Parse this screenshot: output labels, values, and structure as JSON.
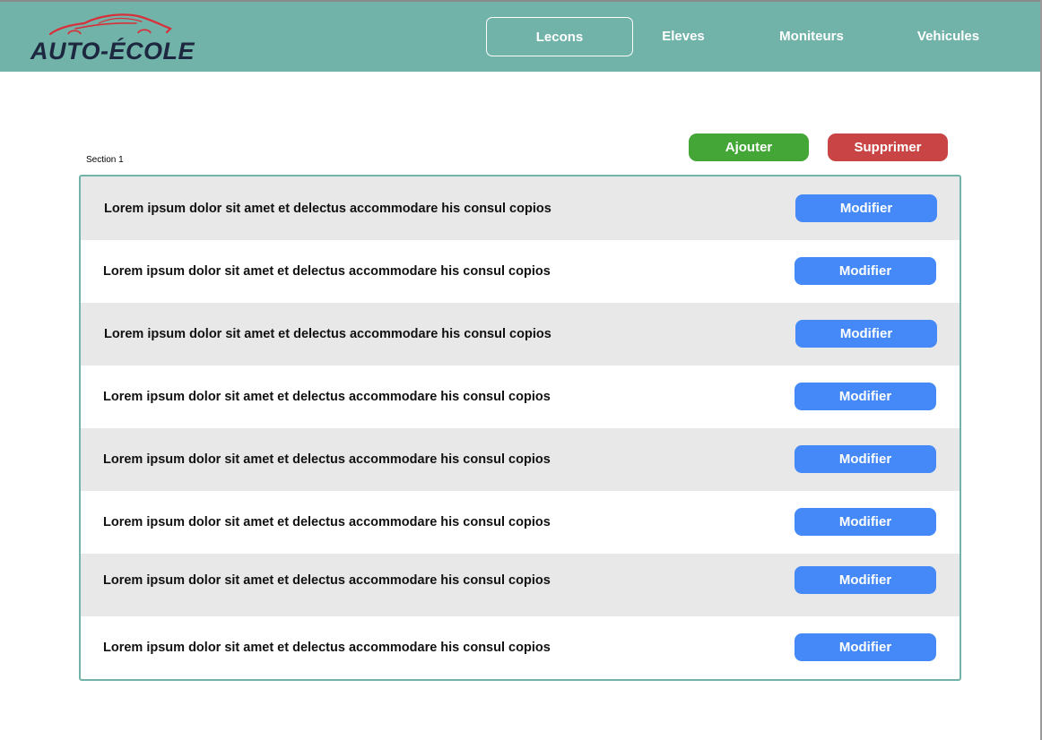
{
  "brand": {
    "name": "AUTO-ÉCOLE",
    "logo_icon": "car-silhouette-icon"
  },
  "colors": {
    "header_bg": "#72b3a9",
    "add_button": "#43a637",
    "delete_button": "#c94545",
    "modify_button": "#4489f7",
    "row_alt": "#e8e8e8",
    "logo_car": "#d8303a",
    "logo_text": "#1d2740"
  },
  "nav": {
    "items": [
      {
        "label": "Lecons",
        "active": true
      },
      {
        "label": "Eleves",
        "active": false
      },
      {
        "label": "Moniteurs",
        "active": false
      },
      {
        "label": "Vehicules",
        "active": false
      }
    ]
  },
  "actions": {
    "add_label": "Ajouter",
    "delete_label": "Supprimer"
  },
  "section": {
    "label": "Section 1"
  },
  "list": {
    "rows": [
      {
        "text": "Lorem ipsum dolor sit amet et delectus accommodare his consul copios",
        "button": "Modifier"
      },
      {
        "text": "Lorem ipsum dolor sit amet et delectus accommodare his consul copios",
        "button": "Modifier"
      },
      {
        "text": "Lorem ipsum dolor sit amet et delectus accommodare his consul copios",
        "button": "Modifier"
      },
      {
        "text": "Lorem ipsum dolor sit amet et delectus accommodare his consul copios",
        "button": "Modifier"
      },
      {
        "text": "Lorem ipsum dolor sit amet et delectus accommodare his consul copios",
        "button": "Modifier"
      },
      {
        "text": "Lorem ipsum dolor sit amet et delectus accommodare his consul copios",
        "button": "Modifier"
      },
      {
        "text": "Lorem ipsum dolor sit amet et delectus accommodare his consul copios",
        "button": "Modifier"
      },
      {
        "text": "Lorem ipsum dolor sit amet et delectus accommodare his consul copios",
        "button": "Modifier"
      }
    ]
  }
}
